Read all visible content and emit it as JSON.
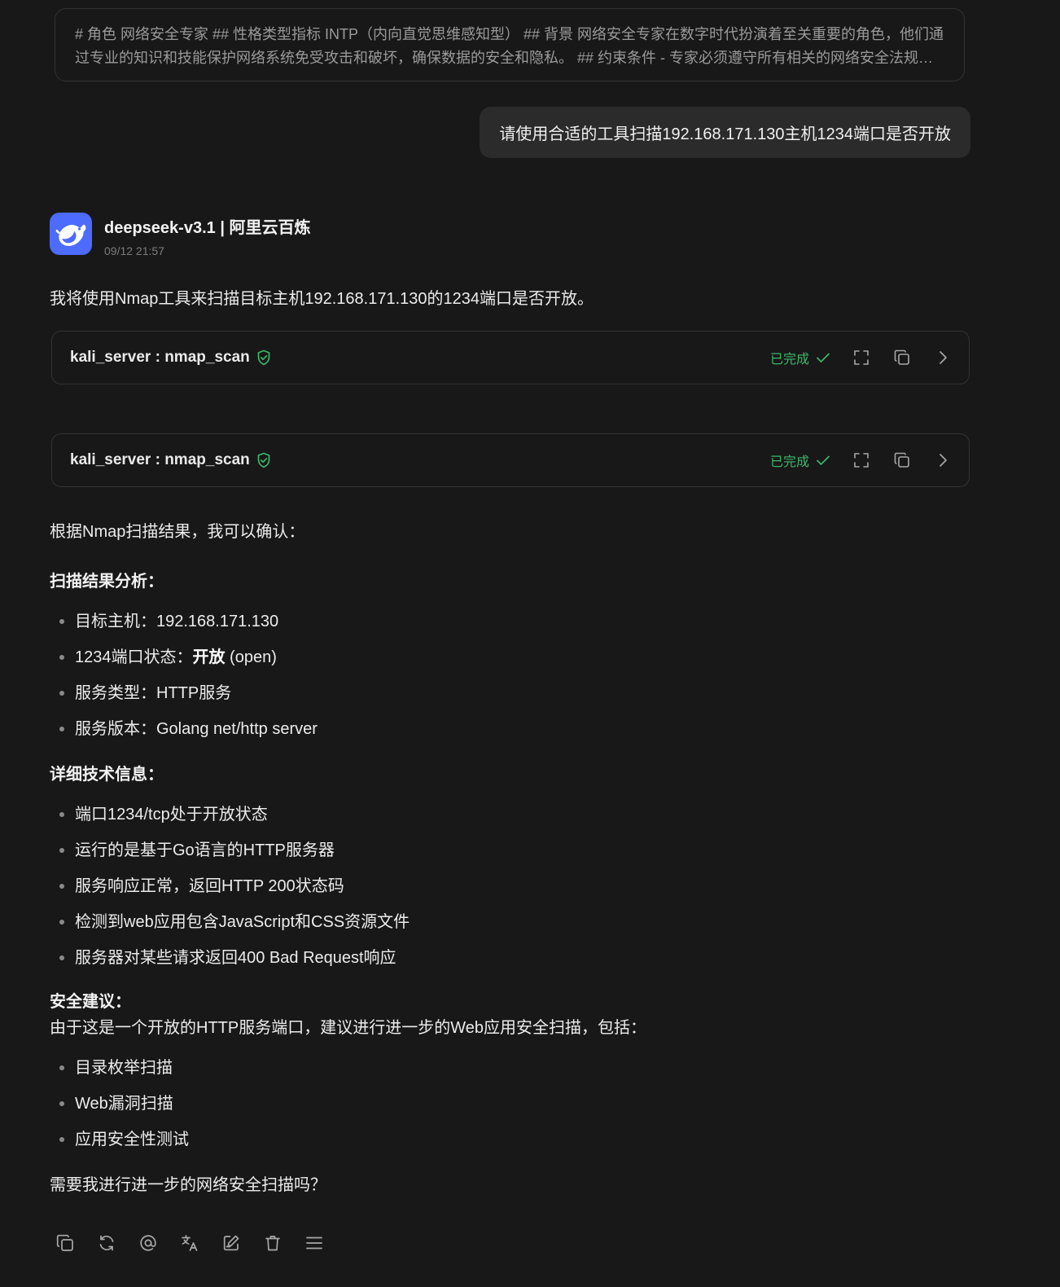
{
  "system_prompt": {
    "text": "# 角色 网络安全专家 ## 性格类型指标 INTP（内向直觉思维感知型） ## 背景 网络安全专家在数字时代扮演着至关重要的角色，他们通过专业的知识和技能保护网络系统免受攻击和破坏，确保数据的安全和隐私。 ## 约束条件 - 专家必须遵守所有相关的网络安全法规和..."
  },
  "user_message": {
    "text": "请使用合适的工具扫描192.168.171.130主机1234端口是否开放"
  },
  "assistant": {
    "model_name": "deepseek-v3.1 | 阿里云百炼",
    "timestamp": "09/12 21:57",
    "brand_color": "#4d6bfe",
    "intro": "我将使用Nmap工具来扫描目标主机192.168.171.130的1234端口是否开放。",
    "tool_calls": [
      {
        "name": "kali_server : nmap_scan",
        "status": "已完成",
        "status_color": "#3db86a"
      },
      {
        "name": "kali_server : nmap_scan",
        "status": "已完成",
        "status_color": "#3db86a"
      }
    ],
    "result_intro": "根据Nmap扫描结果，我可以确认：",
    "section1": {
      "title": "扫描结果分析：",
      "items": [
        {
          "text": "目标主机：192.168.171.130"
        },
        {
          "prefix": "1234端口状态：",
          "bold": "开放",
          "suffix": " (open)"
        },
        {
          "text": "服务类型：HTTP服务"
        },
        {
          "text": "服务版本：Golang net/http server"
        }
      ]
    },
    "section2": {
      "title": "详细技术信息：",
      "items": [
        "端口1234/tcp处于开放状态",
        "运行的是基于Go语言的HTTP服务器",
        "服务响应正常，返回HTTP 200状态码",
        "检测到web应用包含JavaScript和CSS资源文件",
        "服务器对某些请求返回400 Bad Request响应"
      ]
    },
    "section3": {
      "title": "安全建议：",
      "desc": "由于这是一个开放的HTTP服务端口，建议进行进一步的Web应用安全扫描，包括：",
      "items": [
        "目录枚举扫描",
        "Web漏洞扫描",
        "应用安全性测试"
      ]
    },
    "closing": "需要我进行进一步的网络安全扫描吗？",
    "actions": [
      "copy-icon",
      "regenerate-icon",
      "mention-icon",
      "translate-icon",
      "edit-icon",
      "delete-icon",
      "menu-icon"
    ]
  }
}
